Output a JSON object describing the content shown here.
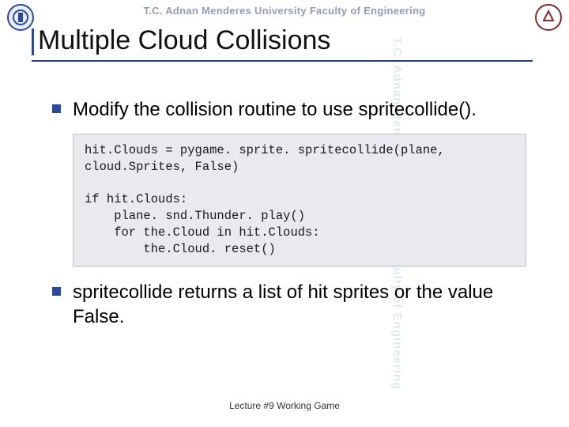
{
  "header": {
    "org_text": "T.C.   Adnan Menderes University   Faculty of Engineering",
    "watermark_right": "T.C.   Adnan Menderes University   Faculty of Engineering"
  },
  "title": "Multiple Cloud Collisions",
  "bullets": [
    "Modify the collision routine to use spritecollide().",
    "spritecollide returns a list of hit sprites or the value False."
  ],
  "code": "hit.Clouds = pygame. sprite. spritecollide(plane,\ncloud.Sprites, False)\n\nif hit.Clouds:\n    plane. snd.Thunder. play()\n    for the.Cloud in hit.Clouds:\n        the.Cloud. reset()",
  "footer": "Lecture #9 Working Game",
  "colors": {
    "accent": "#2a4aa0",
    "rule": "#1f3f8c",
    "codebg": "#e9e9ee"
  }
}
